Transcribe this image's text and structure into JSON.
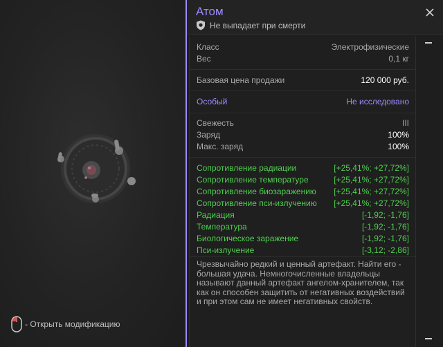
{
  "item": {
    "title": "Атом",
    "drop_note": "Не выпадает при смерти"
  },
  "icons": {
    "close": "close-icon",
    "shield": "shield-icon",
    "mouse": "mouse-icon"
  },
  "colors": {
    "accent": "#9c8cff",
    "positive": "#4fd04f",
    "text_dim": "#a8a8a8",
    "text_bright": "#ffffff",
    "panel_bg": "#1e1e1e"
  },
  "basic": {
    "class_label": "Класс",
    "class_value": "Электрофизические",
    "weight_label": "Вес",
    "weight_value": "0,1 кг"
  },
  "price": {
    "label": "Базовая цена продажи",
    "value": "120 000 руб."
  },
  "rarity": {
    "label": "Особый",
    "value": "Не исследовано"
  },
  "state": {
    "freshness_label": "Свежесть",
    "freshness_value": "III",
    "charge_label": "Заряд",
    "charge_value": "100%",
    "max_charge_label": "Макс. заряд",
    "max_charge_value": "100%"
  },
  "stats": [
    {
      "label": "Сопротивление радиации",
      "value": "[+25,41%; +27,72%]"
    },
    {
      "label": "Сопротивление температуре",
      "value": "[+25,41%; +27,72%]"
    },
    {
      "label": "Сопротивление биозаражению",
      "value": "[+25,41%; +27,72%]"
    },
    {
      "label": "Сопротивление пси-излучению",
      "value": "[+25,41%; +27,72%]"
    },
    {
      "label": "Радиация",
      "value": "[-1,92; -1,76]"
    },
    {
      "label": "Температура",
      "value": "[-1,92; -1,76]"
    },
    {
      "label": "Биологическое заражение",
      "value": "[-1,92; -1,76]"
    },
    {
      "label": "Пси-излучение",
      "value": "[-3,12; -2,86]"
    }
  ],
  "description": "Чрезвычайно редкий и ценный артефакт. Найти его - большая удача. Немногочисленные владельцы называют данный артефакт ангелом-хранителем, так как он способен защитить от негативных воздействий и при этом сам не имеет негативных свойств.",
  "hint": {
    "text": "- Открыть модификацию"
  }
}
